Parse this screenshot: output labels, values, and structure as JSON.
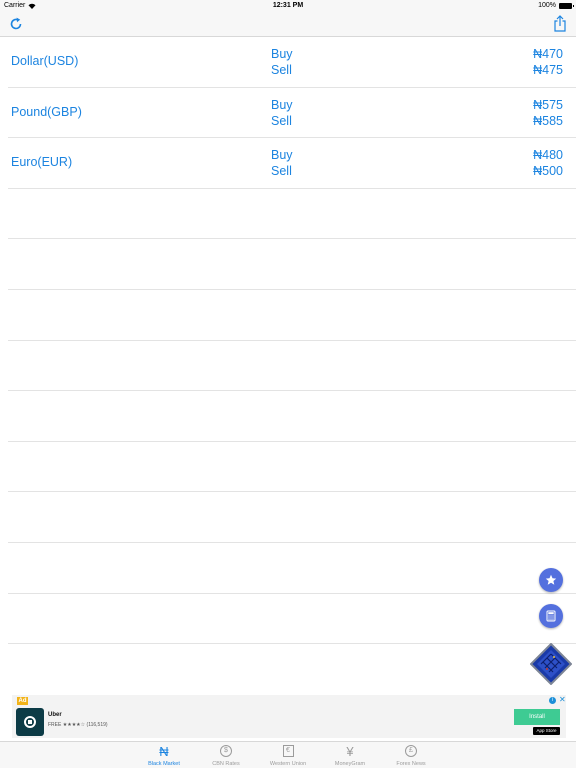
{
  "status_bar": {
    "carrier": "Carrier",
    "time": "12:31 PM",
    "battery": "100%"
  },
  "nav_bar": {
    "left_icon": "refresh-icon",
    "right_icon": "share-icon"
  },
  "colors": {
    "accent": "#1c84e0",
    "fab": "#5470de",
    "install": "#3ecb93"
  },
  "rates": [
    {
      "currency": "Dollar(USD)",
      "buy_label": "Buy",
      "sell_label": "Sell",
      "buy": "₦470",
      "sell": "₦475"
    },
    {
      "currency": "Pound(GBP)",
      "buy_label": "Buy",
      "sell_label": "Sell",
      "buy": "₦575",
      "sell": "₦585"
    },
    {
      "currency": "Euro(EUR)",
      "buy_label": "Buy",
      "sell_label": "Sell",
      "buy": "₦480",
      "sell": "₦500"
    }
  ],
  "ad": {
    "badge": "Ad",
    "app_name": "Uber",
    "subtitle": "FREE ★★★★☆ (116,519)",
    "install": "Install",
    "store": "App Store",
    "info": "i",
    "close": "✕"
  },
  "tabs": [
    {
      "label": "Black Market",
      "icon": "₦"
    },
    {
      "label": "CBN Rates",
      "icon": "$"
    },
    {
      "label": "Western Union",
      "icon": "€"
    },
    {
      "label": "MoneyGram",
      "icon": "¥"
    },
    {
      "label": "Forex News",
      "icon": "£"
    }
  ]
}
